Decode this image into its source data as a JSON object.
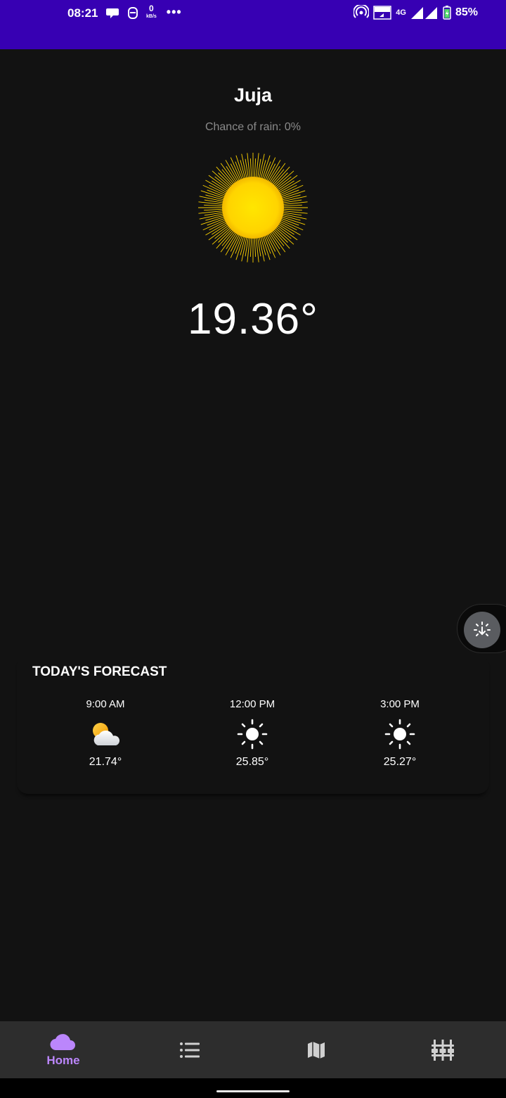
{
  "status_bar": {
    "time": "08:21",
    "data_rate_value": "0",
    "data_rate_unit": "kB/s",
    "network_type": "4G",
    "battery_percent": "85%",
    "icons": [
      "chat-bubble-icon",
      "sim-icon",
      "more-dots-icon",
      "hotspot-icon",
      "volte-icon",
      "signal-icon",
      "battery-icon"
    ]
  },
  "weather": {
    "city": "Juja",
    "chance_of_rain": "Chance of rain: 0%",
    "current_temp": "19.36°",
    "current_icon": "sun-icon"
  },
  "forecast": {
    "title": "TODAY'S FORECAST",
    "items": [
      {
        "time": "9:00 AM",
        "icon": "partly-cloudy-icon",
        "temp": "21.74°"
      },
      {
        "time": "12:00 PM",
        "icon": "sun-icon",
        "temp": "25.85°"
      },
      {
        "time": "3:00 PM",
        "icon": "sun-icon",
        "temp": "25.27°"
      }
    ]
  },
  "bottom_nav": {
    "items": [
      {
        "label": "Home",
        "icon": "cloud-icon",
        "active": true
      },
      {
        "label": "",
        "icon": "list-icon",
        "active": false
      },
      {
        "label": "",
        "icon": "map-icon",
        "active": false
      },
      {
        "label": "",
        "icon": "sliders-icon",
        "active": false
      }
    ]
  },
  "colors": {
    "status_bar": "#3700b3",
    "background": "#121212",
    "accent": "#bb86fc",
    "nav_background": "#2d2d2d"
  }
}
